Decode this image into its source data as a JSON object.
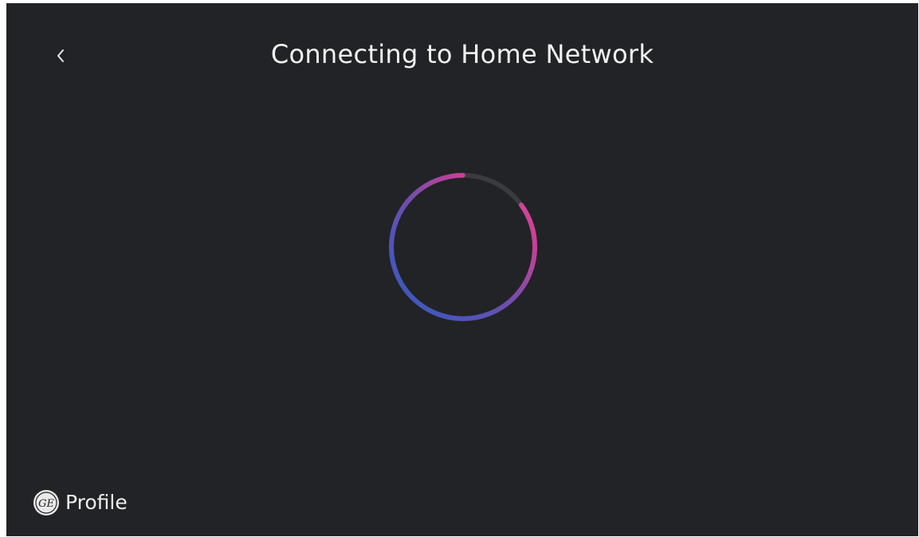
{
  "header": {
    "title": "Connecting to Home Network",
    "back_icon": "chevron-left-icon"
  },
  "spinner": {
    "icon": "loading-spinner-icon",
    "track_color": "#3a3b3e",
    "gradient_colors": [
      "#2f5bc1",
      "#6a4fb0",
      "#c93f97",
      "#d94a9b"
    ]
  },
  "branding": {
    "logo_icon": "ge-monogram-logo",
    "logo_text": "GE",
    "name": "Profile"
  },
  "colors": {
    "background": "#222326",
    "text": "#f2f2f2"
  }
}
